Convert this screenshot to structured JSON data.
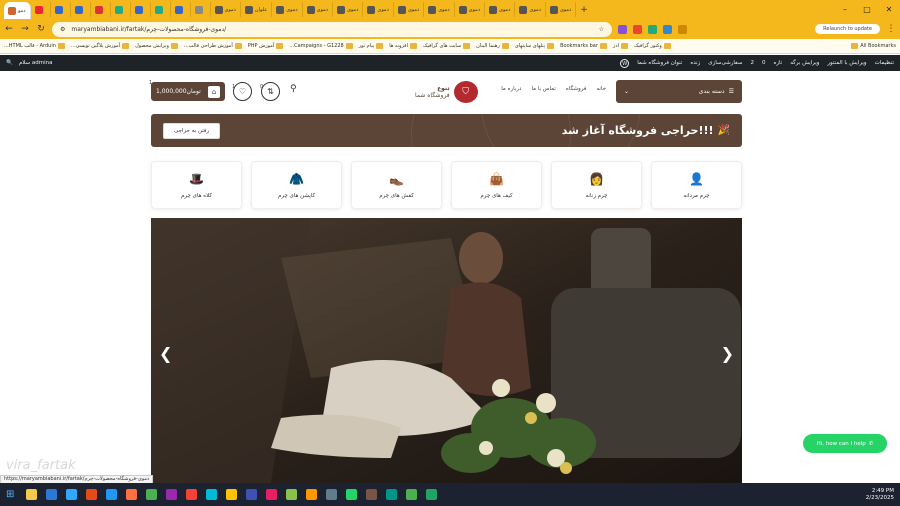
{
  "browser": {
    "tabs": [
      {
        "label": "دمو",
        "color": "#c63"
      },
      {
        "label": "",
        "color": "#e23"
      },
      {
        "label": "",
        "color": "#36c"
      },
      {
        "label": "",
        "color": "#36c"
      },
      {
        "label": "",
        "color": "#d33"
      },
      {
        "label": "",
        "color": "#2a8"
      },
      {
        "label": "",
        "color": "#36c"
      },
      {
        "label": "",
        "color": "#2a8"
      },
      {
        "label": "",
        "color": "#36c"
      },
      {
        "label": "",
        "color": "#888"
      },
      {
        "label": "دموی",
        "color": "#555"
      },
      {
        "label": "علوان",
        "color": "#555"
      },
      {
        "label": "دموی",
        "color": "#555"
      },
      {
        "label": "دموی",
        "color": "#555"
      },
      {
        "label": "دموی",
        "color": "#555"
      },
      {
        "label": "دموی",
        "color": "#555"
      },
      {
        "label": "دموی",
        "color": "#555"
      },
      {
        "label": "دموی",
        "color": "#555"
      },
      {
        "label": "دموی",
        "color": "#555"
      },
      {
        "label": "دموی",
        "color": "#555"
      },
      {
        "label": "دموی",
        "color": "#555"
      },
      {
        "label": "دموی",
        "color": "#555"
      }
    ],
    "active_tab": "دمو",
    "new_tab": "+",
    "url": "maryambiabani.ir/fartak/دموی-فروشگاه-محصولات-چرم/",
    "relaunch": "Relaunch to update",
    "bookmarks": [
      "وکتور گرافیک",
      "ادز",
      "Bookmarks bar",
      "پنلهای سایتهای",
      "رهنما البنان",
      "سایت های گرافیک",
      "افزونه ها",
      "پیام نور",
      "Campaigns - G1228...",
      "آموزش PHP",
      "آموزش طراحی قالب...",
      "ویرایش محصول",
      "آموزش پلاگین نویسی...",
      "Arduin - قالب HTML..."
    ],
    "all_bookmarks": "All Bookmarks"
  },
  "wpbar": {
    "user": "سلام admina",
    "items": [
      "تنظیمات",
      "ویرایش با المنتور",
      "ویرایش برگه",
      "تازه",
      "0",
      "2",
      "سفارشی‌سازی",
      "زنده",
      "تنوان فروشگاه شما"
    ]
  },
  "header": {
    "categories_button": "دسته بندی",
    "nav": [
      "خانه",
      "فروشگاه",
      "تماس با ما",
      "درباره ما"
    ],
    "logo_line1": "تنوع",
    "logo_line2": "فروشگاه شما",
    "cart_amount": "1,000,000تومان",
    "cart_count": "1",
    "wishlist_count": "1",
    "compare_count": "0"
  },
  "sale": {
    "text": "حراجی فروشگاه آغاز شد!!!",
    "button": "رفتن به حراجی"
  },
  "categories": [
    {
      "label": "چرم مردانه",
      "icon": "man-icon"
    },
    {
      "label": "چرم زنانه",
      "icon": "woman-icon"
    },
    {
      "label": "کیف های چرم",
      "icon": "bag-icon"
    },
    {
      "label": "کفش های چرم",
      "icon": "shoe-icon"
    },
    {
      "label": "کاپشن های چرم",
      "icon": "jacket-icon"
    },
    {
      "label": "کلاه های چرم",
      "icon": "hat-icon"
    }
  ],
  "status_link": "https://maryambiabani.ir/fartak/دموی-فروشگاه-محصولات-چرم",
  "watermark": "vira_fartak",
  "chat": "Hi, how can I help",
  "clock": {
    "time": "2:49 PM",
    "date": "2/23/2025"
  },
  "colors": {
    "brand": "#5c4436",
    "chrome": "#f5b81c",
    "whatsapp": "#25d366",
    "logo": "#b2292e"
  }
}
